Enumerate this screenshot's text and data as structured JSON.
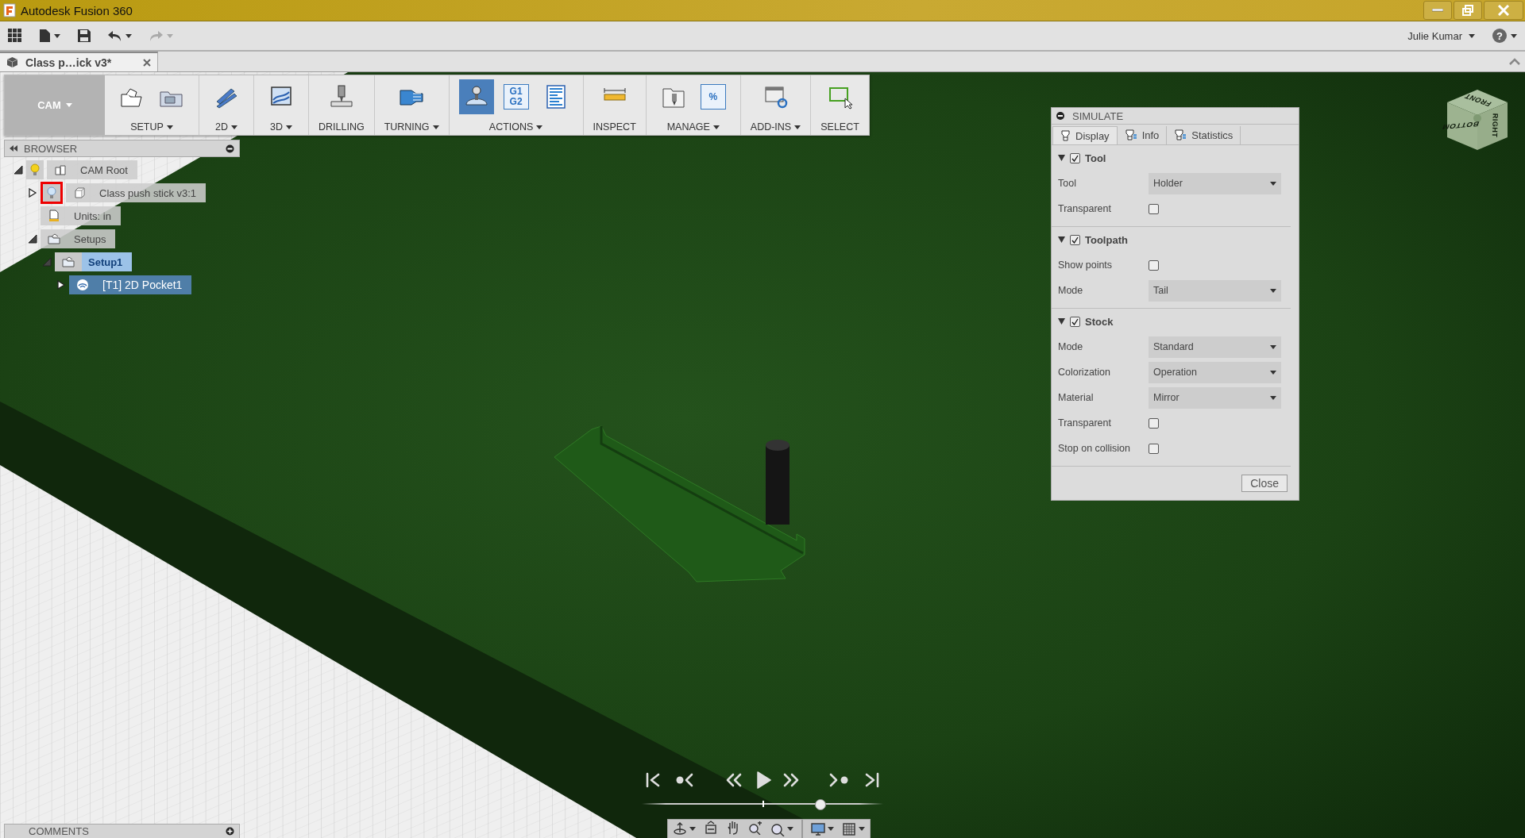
{
  "window": {
    "title": "Autodesk Fusion 360"
  },
  "quick_access": {
    "undo": {
      "disabled": false
    },
    "redo": {
      "disabled": true
    },
    "user": "Julie Kumar",
    "help": "?"
  },
  "document_tabs": [
    {
      "title": "Class p…ick v3*",
      "selected": true
    }
  ],
  "toolbar": {
    "workspace": "CAM",
    "groups": [
      {
        "label": "SETUP",
        "dropdown": true,
        "tools": [
          {
            "active": false
          },
          {
            "active": false
          }
        ]
      },
      {
        "label": "2D",
        "dropdown": true,
        "tools": [
          {
            "active": false
          }
        ]
      },
      {
        "label": "3D",
        "dropdown": true,
        "tools": [
          {
            "active": false
          }
        ]
      },
      {
        "label": "DRILLING",
        "dropdown": false,
        "tools": [
          {
            "active": false
          }
        ]
      },
      {
        "label": "TURNING",
        "dropdown": true,
        "tools": [
          {
            "active": false
          }
        ]
      },
      {
        "label": "ACTIONS",
        "dropdown": true,
        "tools": [
          {
            "active": true
          },
          {
            "active": false,
            "lines": [
              "G1",
              "G2"
            ]
          },
          {
            "active": false
          }
        ]
      },
      {
        "label": "INSPECT",
        "dropdown": false,
        "tools": [
          {
            "active": false
          }
        ]
      },
      {
        "label": "MANAGE",
        "dropdown": true,
        "tools": [
          {
            "active": false
          },
          {
            "active": false,
            "lines": [
              "%"
            ]
          }
        ]
      },
      {
        "label": "ADD-INS",
        "dropdown": true,
        "tools": [
          {
            "active": false
          }
        ]
      },
      {
        "label": "SELECT",
        "dropdown": false,
        "tools": [
          {
            "active": false
          }
        ]
      }
    ]
  },
  "browser": {
    "title": "BROWSER",
    "tree": [
      {
        "label": "CAM Root",
        "kind": "root",
        "visible": true,
        "expanded": true,
        "selected": false,
        "active": false,
        "outlined": false,
        "children": [
          {
            "label": "Class push stick v3:1",
            "kind": "component",
            "visible": false,
            "expanded": false,
            "selected": false,
            "active": false,
            "outlined": true
          },
          {
            "label": "Units: in",
            "kind": "units",
            "selected": false,
            "active": false
          },
          {
            "label": "Setups",
            "kind": "folder",
            "expanded": true,
            "selected": false,
            "active": false,
            "children": [
              {
                "label": "Setup1",
                "kind": "setup",
                "expanded": true,
                "selected": false,
                "active": true,
                "children": [
                  {
                    "label": "[T1] 2D Pocket1",
                    "kind": "operation",
                    "expanded": false,
                    "selected": true,
                    "active": false
                  }
                ]
              }
            ]
          }
        ]
      }
    ]
  },
  "simulate": {
    "title": "SIMULATE",
    "tabs": [
      {
        "label": "Display",
        "selected": true
      },
      {
        "label": "Info",
        "selected": false
      },
      {
        "label": "Statistics",
        "selected": false
      }
    ],
    "sections": [
      {
        "title": "Tool",
        "checked": true,
        "expanded": true,
        "rows": [
          {
            "kind": "dropdown",
            "label": "Tool",
            "value": "Holder"
          },
          {
            "kind": "checkbox",
            "label": "Transparent",
            "checked": false
          }
        ]
      },
      {
        "title": "Toolpath",
        "checked": true,
        "expanded": true,
        "rows": [
          {
            "kind": "checkbox",
            "label": "Show points",
            "checked": false
          },
          {
            "kind": "dropdown",
            "label": "Mode",
            "value": "Tail"
          }
        ]
      },
      {
        "title": "Stock",
        "checked": true,
        "expanded": true,
        "rows": [
          {
            "kind": "dropdown",
            "label": "Mode",
            "value": "Standard"
          },
          {
            "kind": "dropdown",
            "label": "Colorization",
            "value": "Operation"
          },
          {
            "kind": "dropdown",
            "label": "Material",
            "value": "Mirror"
          },
          {
            "kind": "checkbox",
            "label": "Transparent",
            "checked": false
          },
          {
            "kind": "checkbox",
            "label": "Stop on collision",
            "checked": false
          }
        ]
      }
    ],
    "close_button": "Close"
  },
  "playback": {
    "level": 0.74
  },
  "view_cube": {
    "faces": [
      "FRONT",
      "RIGHT",
      "BOTTOM"
    ]
  },
  "comments": {
    "title": "COMMENTS"
  }
}
